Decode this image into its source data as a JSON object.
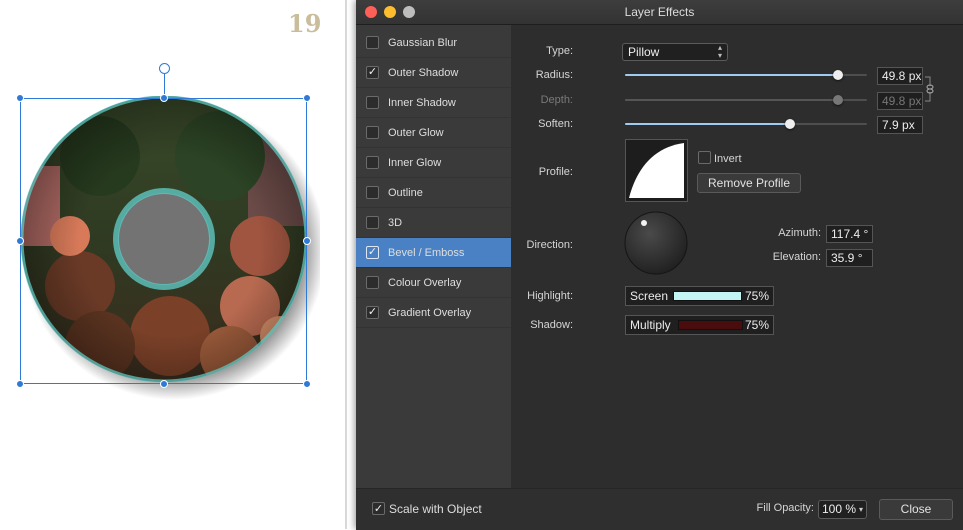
{
  "canvas": {
    "step_number": "19"
  },
  "dialog": {
    "title": "Layer Effects",
    "effects": [
      {
        "label": "Gaussian Blur",
        "checked": false,
        "selected": false
      },
      {
        "label": "Outer Shadow",
        "checked": true,
        "selected": false
      },
      {
        "label": "Inner Shadow",
        "checked": false,
        "selected": false
      },
      {
        "label": "Outer Glow",
        "checked": false,
        "selected": false
      },
      {
        "label": "Inner Glow",
        "checked": false,
        "selected": false
      },
      {
        "label": "Outline",
        "checked": false,
        "selected": false
      },
      {
        "label": "3D",
        "checked": false,
        "selected": false
      },
      {
        "label": "Bevel / Emboss",
        "checked": true,
        "selected": true
      },
      {
        "label": "Colour Overlay",
        "checked": false,
        "selected": false
      },
      {
        "label": "Gradient Overlay",
        "checked": true,
        "selected": false
      }
    ],
    "type": {
      "label": "Type:",
      "value": "Pillow"
    },
    "radius": {
      "label": "Radius:",
      "value": "49.8 px",
      "fraction": 0.88
    },
    "depth": {
      "label": "Depth:",
      "value": "49.8 px",
      "fraction": 0.88
    },
    "soften": {
      "label": "Soften:",
      "value": "7.9 px",
      "fraction": 0.68
    },
    "profile": {
      "label": "Profile:",
      "invert_label": "Invert",
      "remove_label": "Remove Profile"
    },
    "direction": {
      "label": "Direction:"
    },
    "azimuth": {
      "label": "Azimuth:",
      "value": "117.4 °"
    },
    "elevation": {
      "label": "Elevation:",
      "value": "35.9 °"
    },
    "highlight": {
      "label": "Highlight:",
      "mode": "Screen",
      "color": "#c2f5f4",
      "opacity": "75%"
    },
    "shadow": {
      "label": "Shadow:",
      "mode": "Multiply",
      "color": "#4a0c0c",
      "opacity": "75%"
    },
    "scale_with_object": {
      "label": "Scale with Object",
      "checked": true
    },
    "fill_opacity": {
      "label": "Fill Opacity:",
      "value": "100 %"
    },
    "close_label": "Close"
  },
  "colors": {
    "selection": "#2f7ad6",
    "accent": "#4a81c4",
    "slider": "#9fcbf2"
  }
}
